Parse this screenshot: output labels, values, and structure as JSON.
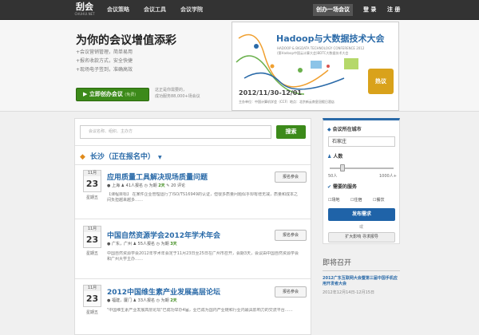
{
  "header": {
    "logo": "刮会",
    "logo_sub": "CHUHUI.NET",
    "nav": [
      "会议策略",
      "会议工具",
      "会议学院"
    ],
    "create_label": "创办一场会议",
    "login_label": "登 录",
    "register_label": "注 册"
  },
  "hero": {
    "slogan": "为你的会议增值添彩",
    "features": [
      "+会议营销管理，简单易用",
      "+报名收款方式，安全快捷",
      "+现场电子签到，准确高效"
    ],
    "cta_label": "立即创办会议",
    "cta_tag": "(免费)",
    "cta_note_1": "这正是你需要的，",
    "cta_note_2": "成功服务88,000+场会议"
  },
  "banner": {
    "title": "Hadoop与大数据技术大会",
    "subtitle": "HADOOP & BIGDATA TECHNOLOGY CONFERENCE 2012",
    "subtitle2": "(第Hadoop中国云计算大会)BDTC大数据技术大会",
    "date": "2012/11/30-12/01",
    "location": "主办单位：中国计算机学会（CCF）地点：北京新云南皇冠假日酒店",
    "badge": "热议"
  },
  "search": {
    "placeholder": "会议名称、组织、主办方",
    "button": "搜索"
  },
  "city": {
    "label": "长沙（正在报名中）"
  },
  "events": [
    {
      "month": "11月",
      "day": "23",
      "weekday": "星期五",
      "title": "应用质量工具解决现场质量问题",
      "location": "上海",
      "signups": "41人报名",
      "duration": "为期",
      "days": "2天",
      "comments": "20 评论",
      "desc": "【课程目标】 在某件企业管理运行了ISO/TS16949的认证，但很多质量问题似乎却有增无减，质量和成本之间负担越来越多……",
      "button": "报名参会"
    },
    {
      "month": "11月",
      "day": "23",
      "weekday": "星期五",
      "title": "中国自然资源学会2012年学术年会",
      "location": "广东，广州",
      "signups": "55人报名",
      "duration": "为期",
      "days": "3天",
      "comments": "",
      "desc": "中国自然资源学会2012年学术年会定于11月23日至25日在广州市召开，会期3天，会议由中国自然资源学会和广州大学主办……",
      "button": "报名参会"
    },
    {
      "month": "11月",
      "day": "23",
      "weekday": "星期五",
      "title": "2012中国维生素产业发展高层论坛",
      "location": "福建，厦门",
      "signups": "33人报名",
      "duration": "为期",
      "days": "2天",
      "comments": "",
      "desc": "\"中国维生素产业发展高层论坛\"已成功举办4届，业已成为国内产业链和行业内最具影响力的交流平台……",
      "button": "报名参会"
    }
  ],
  "sidebar": {
    "city_label": "会议所在城市",
    "city_value": "石家庄",
    "people_label": "人数",
    "min_label": "50人",
    "max_label": "1000人+",
    "service_label": "需要的服务",
    "options": [
      "场地",
      "住宿",
      "餐饮"
    ],
    "publish_button": "发布需求",
    "or_label": "或",
    "extend_button": "扩大影响 寻求报导"
  },
  "upcoming": {
    "header": "即将召开",
    "title": "2012广东互联网大会暨第三届中国手机应用开发者大会",
    "date": "2012年12月14日-12月15日"
  }
}
